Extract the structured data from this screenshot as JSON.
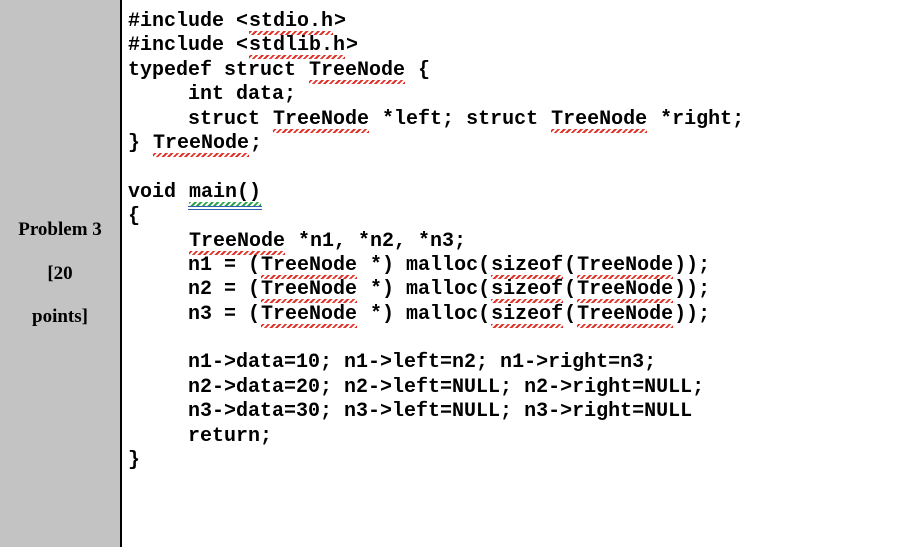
{
  "sidebar": {
    "title": "Problem 3",
    "points_line1": "[20",
    "points_line2": "points]"
  },
  "code": {
    "l1": {
      "a": "#include <",
      "b": "stdio.h",
      "c": ">"
    },
    "l2": {
      "a": "#include <",
      "b": "stdlib.h",
      "c": ">"
    },
    "l3": {
      "a": "typedef struct ",
      "b": "TreeNode",
      "c": " {"
    },
    "l4": {
      "a": "     int data;"
    },
    "l5": {
      "a": "     struct ",
      "b": "TreeNode",
      "c": " *left; struct ",
      "d": "TreeNode",
      "e": " *right;"
    },
    "l6": {
      "a": "} ",
      "b": "TreeNode",
      "c": ";"
    },
    "l8": {
      "a": "void ",
      "b": "main()"
    },
    "l9": {
      "a": "{"
    },
    "l10": {
      "a": "     ",
      "b": "TreeNode",
      "c": " *n1, *n2, *n3;"
    },
    "l11": {
      "a": "     n1 = (",
      "b": "TreeNode",
      "c": " *) malloc(",
      "d": "sizeof",
      "e": "(",
      "f": "TreeNode",
      "g": "));"
    },
    "l12": {
      "a": "     n2 = (",
      "b": "TreeNode",
      "c": " *) malloc(",
      "d": "sizeof",
      "e": "(",
      "f": "TreeNode",
      "g": "));"
    },
    "l13": {
      "a": "     n3 = (",
      "b": "TreeNode",
      "c": " *) malloc(",
      "d": "sizeof",
      "e": "(",
      "f": "TreeNode",
      "g": "));"
    },
    "l15": {
      "a": "     n1->data=10; n1->left=n2; n1->right=n3;"
    },
    "l16": {
      "a": "     n2->data=20; n2->left=NULL; n2->right=NULL;"
    },
    "l17": {
      "a": "     n3->data=30; n3->left=NULL; n3->right=NULL"
    },
    "l18": {
      "a": "     return;"
    },
    "l19": {
      "a": "}"
    }
  }
}
